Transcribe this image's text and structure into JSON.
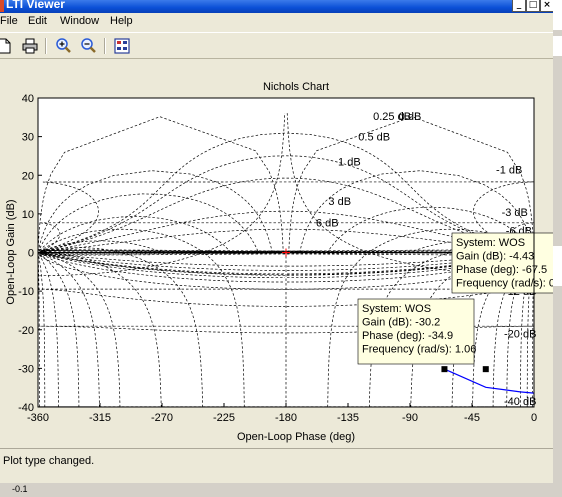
{
  "window": {
    "title": "LTI Viewer",
    "controls": {
      "minimize": "_",
      "maximize": "□",
      "close": "×"
    }
  },
  "menu": [
    "File",
    "Edit",
    "Window",
    "Help"
  ],
  "toolbar": {
    "tools": [
      {
        "name": "new-icon"
      },
      {
        "name": "print-icon"
      },
      {
        "name": "zoom-in-icon"
      },
      {
        "name": "zoom-out-icon"
      },
      {
        "name": "plot-configurations-icon"
      }
    ]
  },
  "status": "Plot type changed.",
  "background_text": {
    "left_tick": "-0.1"
  },
  "colors": {
    "grid": "#000000",
    "response": "#0000ff",
    "critical_point": "#ff0000",
    "datatip_bg": "#ffffe1"
  },
  "chart_data": {
    "type": "line",
    "title": "Nichols Chart",
    "xlabel": "Open-Loop Phase (deg)",
    "ylabel": "Open-Loop Gain (dB)",
    "xlim": [
      -360,
      0
    ],
    "ylim": [
      -40,
      40
    ],
    "xticks": [
      "-360",
      "-315",
      "-270",
      "-225",
      "-180",
      "-135",
      "-90",
      "-45",
      "0"
    ],
    "yticks": [
      "40",
      "30",
      "20",
      "10",
      "0",
      "-10",
      "-20",
      "-30",
      "-40"
    ],
    "grid": true,
    "contour_labels": [
      "0 dB",
      "0.25 dB",
      "0.5 dB",
      "1 dB",
      "3 dB",
      "6 dB",
      "-1 dB",
      "-3 dB",
      "-6 dB",
      "-12 dB",
      "-20 dB",
      "-40 dB"
    ],
    "series": [
      {
        "name": "WOS",
        "points": [
          [
            -65,
            -30.2
          ],
          [
            -35,
            -34.9
          ],
          [
            -20,
            -35.6
          ],
          [
            -10,
            -36.1
          ],
          [
            0,
            -36.4
          ]
        ]
      }
    ],
    "markers": [
      {
        "type": "critical-point",
        "x": -180,
        "y": 0
      },
      {
        "type": "datatip-point",
        "x": -10,
        "y": 0
      },
      {
        "type": "datatip-point",
        "x": -65,
        "y": -30.2
      },
      {
        "type": "datatip-point",
        "x": -35,
        "y": -30.2
      }
    ],
    "datatips": [
      {
        "anchor_x": -10,
        "anchor_y": 0,
        "lines": [
          "System: WOS",
          "Gain (dB): -4.43",
          "Phase (deg): -67.5",
          "Frequency (rad/s): 0"
        ]
      },
      {
        "anchor_x": -65,
        "anchor_y": -30.2,
        "lines": [
          "System: WOS",
          "Gain (dB): -30.2",
          "Phase (deg): -34.9",
          "Frequency (rad/s): 1.06"
        ]
      }
    ]
  }
}
